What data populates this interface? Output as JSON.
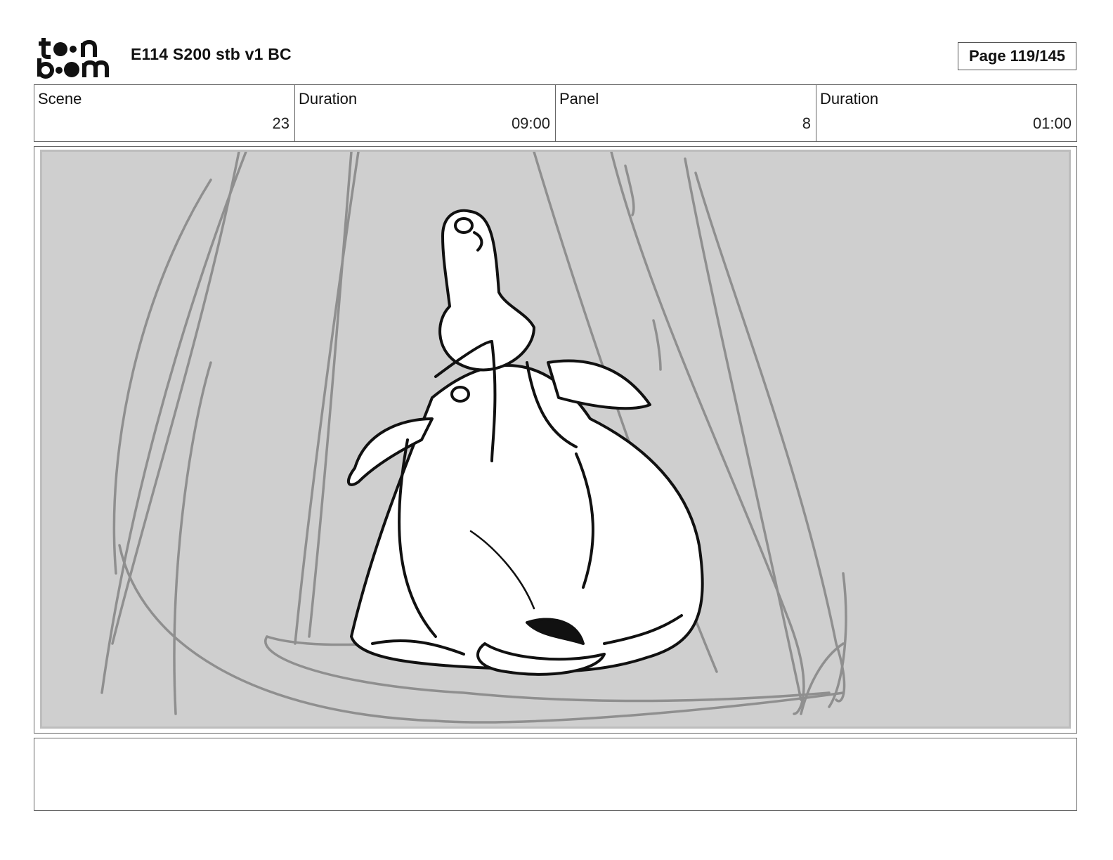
{
  "header": {
    "logo_text_top": "toon",
    "logo_text_bottom": "boom",
    "title": "E114 S200 stb v1 BC",
    "page": "Page 119/145"
  },
  "info": [
    {
      "label": "Scene",
      "value": "23"
    },
    {
      "label": "Duration",
      "value": "09:00"
    },
    {
      "label": "Panel",
      "value": "8"
    },
    {
      "label": "Duration",
      "value": "01:00"
    }
  ],
  "panel": {
    "image": "storyboard-sketch-penguin-icon",
    "background": "#cfcfcf"
  },
  "notes": {
    "text": ""
  }
}
